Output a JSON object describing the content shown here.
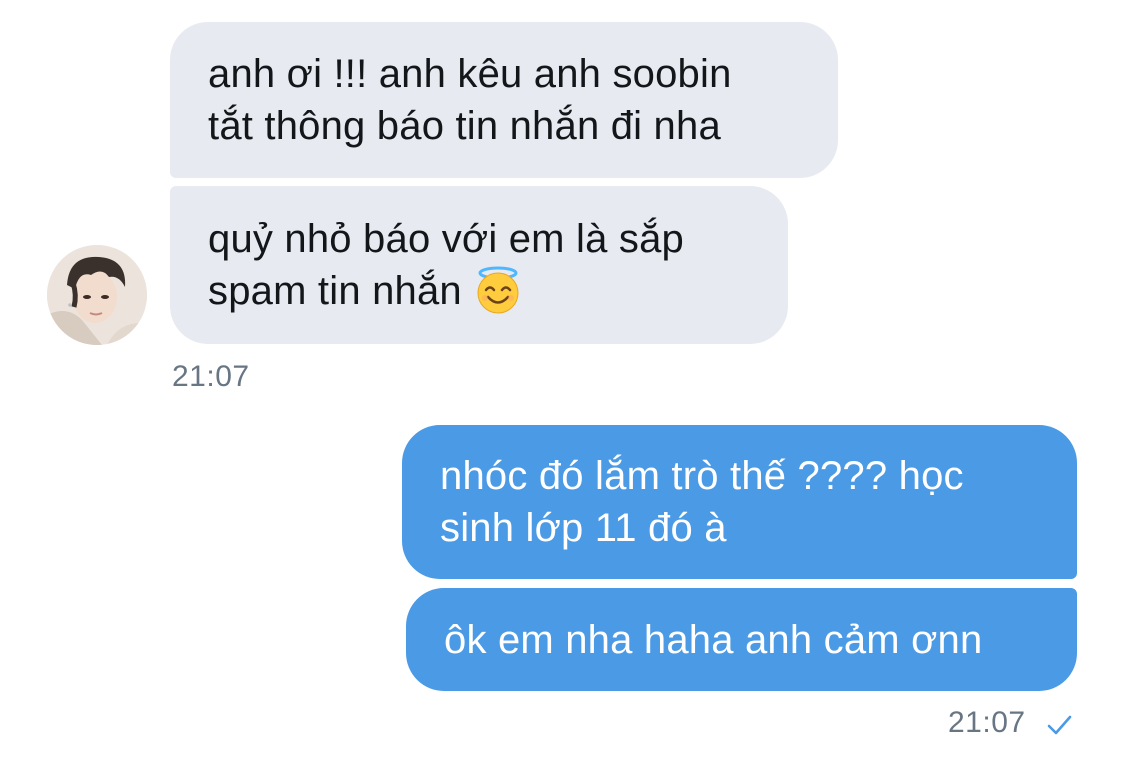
{
  "conversation": {
    "incoming_messages": [
      {
        "lines": [
          "anh ơi !!! anh kêu anh soobin",
          "tắt thông báo tin nhắn đi nha"
        ]
      },
      {
        "lines": [
          "quỷ nhỏ báo với em là sắp",
          "spam tin nhắn"
        ],
        "emoji": "smiling-face-with-halo-icon"
      }
    ],
    "incoming_time": "21:07",
    "outgoing_messages": [
      {
        "lines": [
          "nhóc đó lắm trò thế ???? học",
          "sinh lớp 11 đó à"
        ]
      },
      {
        "lines": [
          "ôk em nha haha anh cảm ơnn"
        ]
      }
    ],
    "outgoing_time": "21:07",
    "outgoing_status_icon": "checkmark-icon"
  },
  "colors": {
    "incoming_bubble": "#e7eaf1",
    "outgoing_bubble": "#4b9ae6",
    "timestamp": "#687684",
    "check": "#4b9ae6"
  }
}
